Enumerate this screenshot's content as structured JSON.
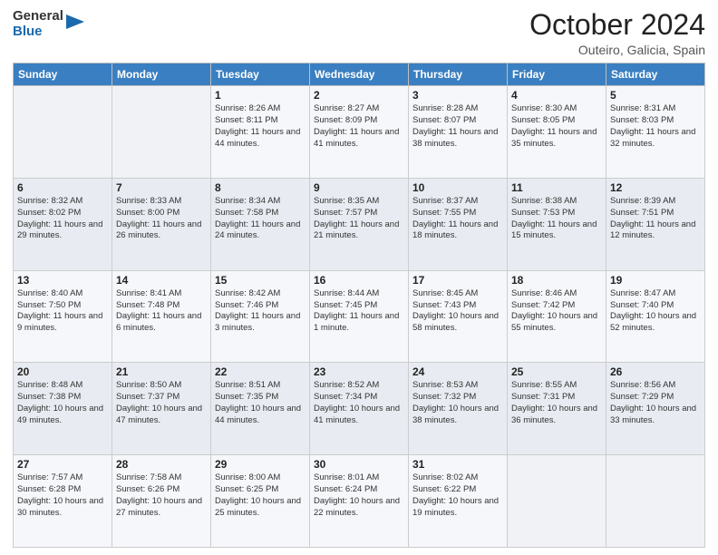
{
  "header": {
    "logo_general": "General",
    "logo_blue": "Blue",
    "month": "October 2024",
    "location": "Outeiro, Galicia, Spain"
  },
  "weekdays": [
    "Sunday",
    "Monday",
    "Tuesday",
    "Wednesday",
    "Thursday",
    "Friday",
    "Saturday"
  ],
  "weeks": [
    [
      {
        "day": "",
        "info": ""
      },
      {
        "day": "",
        "info": ""
      },
      {
        "day": "1",
        "info": "Sunrise: 8:26 AM\nSunset: 8:11 PM\nDaylight: 11 hours and 44 minutes."
      },
      {
        "day": "2",
        "info": "Sunrise: 8:27 AM\nSunset: 8:09 PM\nDaylight: 11 hours and 41 minutes."
      },
      {
        "day": "3",
        "info": "Sunrise: 8:28 AM\nSunset: 8:07 PM\nDaylight: 11 hours and 38 minutes."
      },
      {
        "day": "4",
        "info": "Sunrise: 8:30 AM\nSunset: 8:05 PM\nDaylight: 11 hours and 35 minutes."
      },
      {
        "day": "5",
        "info": "Sunrise: 8:31 AM\nSunset: 8:03 PM\nDaylight: 11 hours and 32 minutes."
      }
    ],
    [
      {
        "day": "6",
        "info": "Sunrise: 8:32 AM\nSunset: 8:02 PM\nDaylight: 11 hours and 29 minutes."
      },
      {
        "day": "7",
        "info": "Sunrise: 8:33 AM\nSunset: 8:00 PM\nDaylight: 11 hours and 26 minutes."
      },
      {
        "day": "8",
        "info": "Sunrise: 8:34 AM\nSunset: 7:58 PM\nDaylight: 11 hours and 24 minutes."
      },
      {
        "day": "9",
        "info": "Sunrise: 8:35 AM\nSunset: 7:57 PM\nDaylight: 11 hours and 21 minutes."
      },
      {
        "day": "10",
        "info": "Sunrise: 8:37 AM\nSunset: 7:55 PM\nDaylight: 11 hours and 18 minutes."
      },
      {
        "day": "11",
        "info": "Sunrise: 8:38 AM\nSunset: 7:53 PM\nDaylight: 11 hours and 15 minutes."
      },
      {
        "day": "12",
        "info": "Sunrise: 8:39 AM\nSunset: 7:51 PM\nDaylight: 11 hours and 12 minutes."
      }
    ],
    [
      {
        "day": "13",
        "info": "Sunrise: 8:40 AM\nSunset: 7:50 PM\nDaylight: 11 hours and 9 minutes."
      },
      {
        "day": "14",
        "info": "Sunrise: 8:41 AM\nSunset: 7:48 PM\nDaylight: 11 hours and 6 minutes."
      },
      {
        "day": "15",
        "info": "Sunrise: 8:42 AM\nSunset: 7:46 PM\nDaylight: 11 hours and 3 minutes."
      },
      {
        "day": "16",
        "info": "Sunrise: 8:44 AM\nSunset: 7:45 PM\nDaylight: 11 hours and 1 minute."
      },
      {
        "day": "17",
        "info": "Sunrise: 8:45 AM\nSunset: 7:43 PM\nDaylight: 10 hours and 58 minutes."
      },
      {
        "day": "18",
        "info": "Sunrise: 8:46 AM\nSunset: 7:42 PM\nDaylight: 10 hours and 55 minutes."
      },
      {
        "day": "19",
        "info": "Sunrise: 8:47 AM\nSunset: 7:40 PM\nDaylight: 10 hours and 52 minutes."
      }
    ],
    [
      {
        "day": "20",
        "info": "Sunrise: 8:48 AM\nSunset: 7:38 PM\nDaylight: 10 hours and 49 minutes."
      },
      {
        "day": "21",
        "info": "Sunrise: 8:50 AM\nSunset: 7:37 PM\nDaylight: 10 hours and 47 minutes."
      },
      {
        "day": "22",
        "info": "Sunrise: 8:51 AM\nSunset: 7:35 PM\nDaylight: 10 hours and 44 minutes."
      },
      {
        "day": "23",
        "info": "Sunrise: 8:52 AM\nSunset: 7:34 PM\nDaylight: 10 hours and 41 minutes."
      },
      {
        "day": "24",
        "info": "Sunrise: 8:53 AM\nSunset: 7:32 PM\nDaylight: 10 hours and 38 minutes."
      },
      {
        "day": "25",
        "info": "Sunrise: 8:55 AM\nSunset: 7:31 PM\nDaylight: 10 hours and 36 minutes."
      },
      {
        "day": "26",
        "info": "Sunrise: 8:56 AM\nSunset: 7:29 PM\nDaylight: 10 hours and 33 minutes."
      }
    ],
    [
      {
        "day": "27",
        "info": "Sunrise: 7:57 AM\nSunset: 6:28 PM\nDaylight: 10 hours and 30 minutes."
      },
      {
        "day": "28",
        "info": "Sunrise: 7:58 AM\nSunset: 6:26 PM\nDaylight: 10 hours and 27 minutes."
      },
      {
        "day": "29",
        "info": "Sunrise: 8:00 AM\nSunset: 6:25 PM\nDaylight: 10 hours and 25 minutes."
      },
      {
        "day": "30",
        "info": "Sunrise: 8:01 AM\nSunset: 6:24 PM\nDaylight: 10 hours and 22 minutes."
      },
      {
        "day": "31",
        "info": "Sunrise: 8:02 AM\nSunset: 6:22 PM\nDaylight: 10 hours and 19 minutes."
      },
      {
        "day": "",
        "info": ""
      },
      {
        "day": "",
        "info": ""
      }
    ]
  ]
}
